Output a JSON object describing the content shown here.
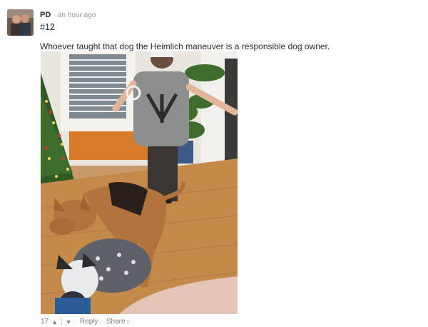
{
  "comment": {
    "author": "PD",
    "time": "an hour ago",
    "number": "#12",
    "text": "Whoever taught that dog the Heimlich maneuver is a responsible dog owner.",
    "votes": "17",
    "reply_label": "Reply",
    "share_label": "Share"
  },
  "icons": {
    "upvote": "chevron-up-icon",
    "downvote": "chevron-down-icon",
    "share_arrow": "chevron-right-icon"
  },
  "colors": {
    "text": "#2a2e2e",
    "muted": "#7b8186",
    "background": "#ffffff"
  }
}
